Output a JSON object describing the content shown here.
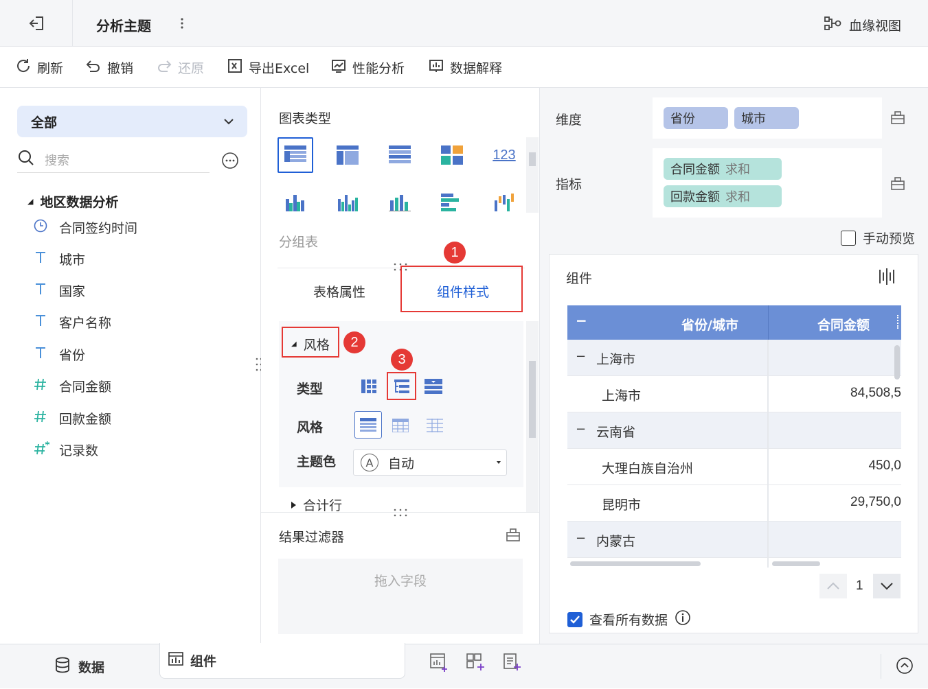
{
  "header": {
    "title": "分析主题",
    "lineage_label": "血缘视图"
  },
  "toolbar": {
    "refresh": "刷新",
    "undo": "撤销",
    "redo": "还原",
    "export": "导出Excel",
    "perf": "性能分析",
    "explain": "数据解释"
  },
  "left": {
    "dropdown_value": "全部",
    "search_placeholder": "搜索",
    "group_label": "地区数据分析",
    "fields": [
      {
        "label": "合同签约时间",
        "type": "date"
      },
      {
        "label": "城市",
        "type": "text"
      },
      {
        "label": "国家",
        "type": "text"
      },
      {
        "label": "客户名称",
        "type": "text"
      },
      {
        "label": "省份",
        "type": "text"
      },
      {
        "label": "合同金额",
        "type": "number"
      },
      {
        "label": "回款金额",
        "type": "number"
      },
      {
        "label": "记录数",
        "type": "count"
      }
    ]
  },
  "mid": {
    "chart_type_title": "图表类型",
    "chart_123": "123",
    "selected_chart_name": "分组表",
    "tabs": [
      "表格属性",
      "组件样式"
    ],
    "style_section": "风格",
    "type_label": "类型",
    "style_label": "风格",
    "theme_label": "主题色",
    "theme_value": "自动",
    "theme_icon_letter": "A",
    "total_row": "合计行",
    "filter_title": "结果过滤器",
    "filter_placeholder": "拖入字段"
  },
  "annotations": [
    "1",
    "2",
    "3"
  ],
  "right": {
    "dimension_label": "维度",
    "dimensions": [
      "省份",
      "城市"
    ],
    "metric_label": "指标",
    "metrics": [
      {
        "name": "合同金额",
        "agg": "求和"
      },
      {
        "name": "回款金额",
        "agg": "求和"
      }
    ],
    "manual_preview": "手动预览",
    "component_label": "组件",
    "table": {
      "collapse_symbol": "−",
      "headers": [
        "省份/城市",
        "合同金额"
      ],
      "rows": [
        {
          "name": "上海市",
          "value": "",
          "level": 0
        },
        {
          "name": "上海市",
          "value": "84,508,5",
          "level": 1
        },
        {
          "name": "云南省",
          "value": "",
          "level": 0
        },
        {
          "name": "大理白族自治州",
          "value": "450,0",
          "level": 1
        },
        {
          "name": "昆明市",
          "value": "29,750,0",
          "level": 1
        },
        {
          "name": "内蒙古",
          "value": "",
          "level": 0
        }
      ]
    },
    "page_number": "1",
    "view_all": "查看所有数据"
  },
  "bottom": {
    "data_tab": "数据",
    "component_tab": "组件"
  },
  "colors": {
    "accent": "#1f5fd6",
    "dimension_pill": "#b5c4e8",
    "metric_pill": "#b5e3dc",
    "table_header": "#6b8fd6",
    "red": "#e53935"
  }
}
